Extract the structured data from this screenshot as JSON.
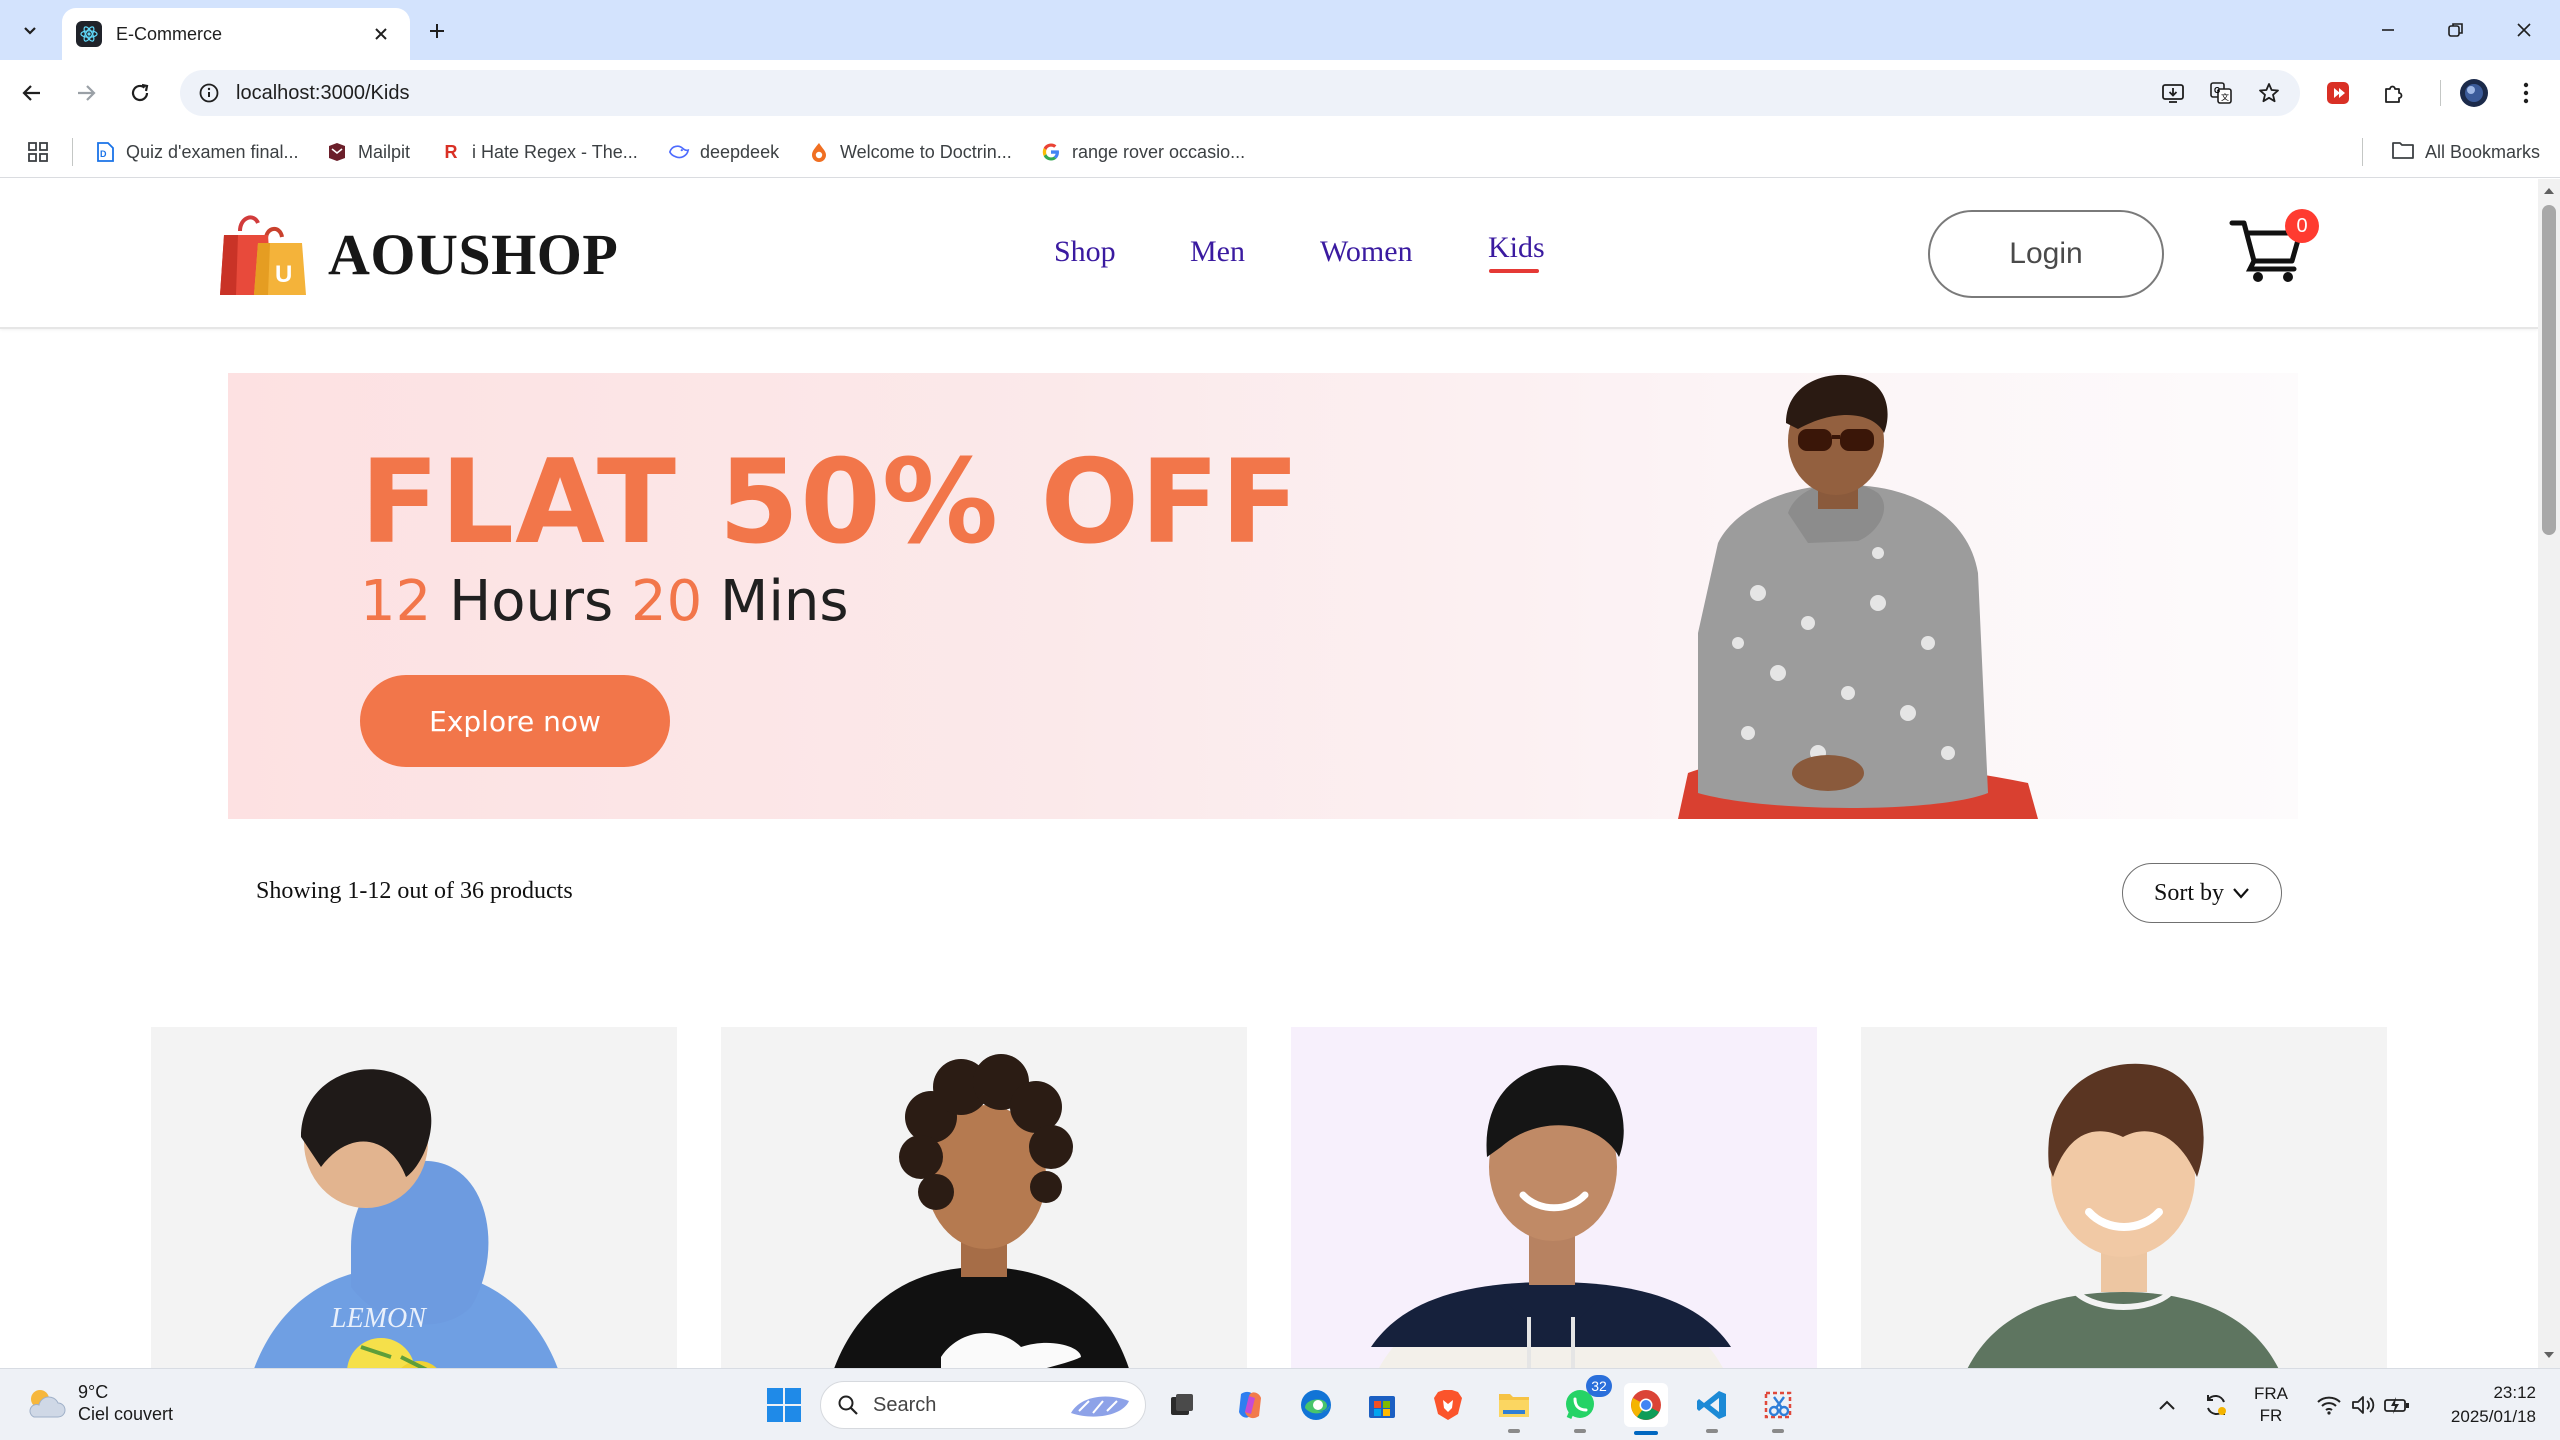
{
  "browser": {
    "tab_title": "E-Commerce",
    "url": "localhost:3000/Kids",
    "bookmarks": [
      {
        "label": "Quiz d'examen final...",
        "icon": "pdf-icon"
      },
      {
        "label": "Mailpit",
        "icon": "mailpit-icon"
      },
      {
        "label": "i Hate Regex - The...",
        "icon": "regex-icon"
      },
      {
        "label": "deepdeek",
        "icon": "deepseek-icon"
      },
      {
        "label": "Welcome to Doctrin...",
        "icon": "doctrine-icon"
      },
      {
        "label": "range rover occasio...",
        "icon": "google-icon"
      }
    ],
    "all_bookmarks": "All Bookmarks"
  },
  "site": {
    "brand": "AOUSHOP",
    "logo_letter": "U",
    "nav": [
      "Shop",
      "Men",
      "Women",
      "Kids"
    ],
    "active_nav": "Kids",
    "login": "Login",
    "cart_count": "0"
  },
  "hero": {
    "headline": "FLAT 50% OFF",
    "timer_hours": "12",
    "timer_hours_label": "Hours",
    "timer_mins": "20",
    "timer_mins_label": "Mins",
    "cta": "Explore now",
    "accent": "#f2764a"
  },
  "listing": {
    "showing": "Showing 1-12 out of 36 products",
    "sort_label": "Sort by"
  },
  "products": [
    {
      "name": "kid-blue-hoodie",
      "print": "LEMON"
    },
    {
      "name": "kid-black-hoodie"
    },
    {
      "name": "kid-navy-white-hoodie"
    },
    {
      "name": "kid-green-tshirt"
    }
  ],
  "taskbar": {
    "temperature": "9°C",
    "weather": "Ciel couvert",
    "search": "Search",
    "whatsapp_badge": "32",
    "lang_top": "FRA",
    "lang_bottom": "FR",
    "time": "23:12",
    "date": "2025/01/18"
  }
}
